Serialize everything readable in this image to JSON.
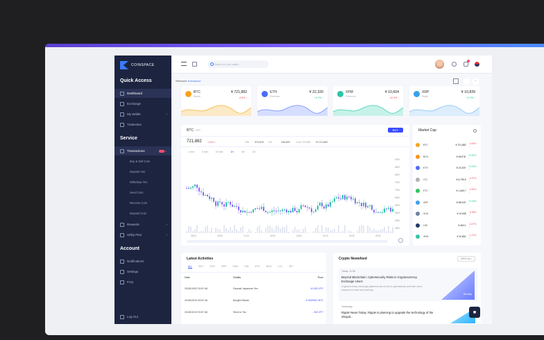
{
  "brand": "COINSPACE",
  "sidebar": {
    "quick_access": "Quick Access",
    "items": [
      "Dashboard",
      "Exchange",
      "My Wallet",
      "Tradeview"
    ],
    "service": "Service",
    "transactions": "Transactions",
    "sub": [
      "Buy & Sell Coin",
      "Deposit Yen",
      "Withdraw Yen",
      "Send Coin",
      "Receive Coin",
      "Deposit Coin"
    ],
    "more": [
      "Rewards",
      "Utility Plan"
    ],
    "account": "Account",
    "acc_items": [
      "Notifications",
      "Settings",
      "FAQ"
    ],
    "logout": "Log Out"
  },
  "search": {
    "placeholder": "Search for coin, wallet..."
  },
  "welcome": {
    "prefix": "Welcome",
    "name": "Koinsaoce"
  },
  "tickers": [
    {
      "name": "BTC",
      "sub": "Bitcoin",
      "price": "¥ 721,882",
      "change": "-4.6% ↓",
      "color": "#f7a41d",
      "up": false
    },
    {
      "name": "ETH",
      "sub": "Ethereum",
      "price": "¥ 22,320",
      "change": "+0.4% ↑",
      "color": "#4a6cf7",
      "up": true
    },
    {
      "name": "XPM",
      "sub": "Primecoin",
      "price": "¥ 10,604",
      "change": "-10.4% ↓",
      "color": "#2ec4a6",
      "up": false
    },
    {
      "name": "XRP",
      "sub": "Ripple",
      "price": "¥ 10,839",
      "change": "+0.4% ↑",
      "color": "#3aa0e8",
      "up": true
    }
  ],
  "chart": {
    "pair": "BTC",
    "pair_sub": "/ JPY",
    "price": "721,882",
    "change": "-4.6% ↓",
    "buy": "BUY",
    "stats": [
      "24h",
      "576,815",
      "Vol",
      "156,800",
      "Low 721,882",
      "Hi 721,882"
    ],
    "timeframes": [
      "1 min",
      "5 min",
      "15 min",
      "1H",
      "4H",
      "1D"
    ],
    "y_ticks": [
      "900K",
      "850K",
      "800K",
      "750K",
      "700K",
      "650K",
      "600K",
      "550K",
      "500K",
      "450K"
    ],
    "x_ticks": [
      "06:00",
      "09:00",
      "12:00",
      "15:00",
      "18:00",
      "21:00",
      "00:00",
      "03:00"
    ]
  },
  "market": {
    "title": "Market Cap",
    "rows": [
      {
        "sym": "BTC",
        "price": "¥ 721,882",
        "chg": "-4.63% ↓",
        "color": "#f7a41d",
        "up": false
      },
      {
        "sym": "BCH",
        "price": "¥ 46,678",
        "chg": "+3.52% ↑",
        "color": "#f7931a",
        "up": true
      },
      {
        "sym": "ETH",
        "price": "¥ 22,320",
        "chg": "+0.43% ↑",
        "color": "#4a6cf7",
        "up": true
      },
      {
        "sym": "LTC",
        "price": "¥ 6,795.5",
        "chg": "-0.37% ↓",
        "color": "#b0b0b0",
        "up": false
      },
      {
        "sym": "ETC",
        "price": "¥ 1,460.7",
        "chg": "-2.81% ↓",
        "color": "#2ec45a",
        "up": false
      },
      {
        "sym": "XRP",
        "price": "¥ 58.029",
        "chg": "+0.44% ↑",
        "color": "#3aa0e8",
        "up": true
      },
      {
        "sym": "XLM",
        "price": "¥ 13.548",
        "chg": "-3.38% ↓",
        "color": "#6e7fa8",
        "up": false
      },
      {
        "sym": "LSK",
        "price": "¥ 483.1",
        "chg": "-0.47% ↓",
        "color": "#1d3a6b",
        "up": false
      },
      {
        "sym": "XEM",
        "price": "¥ 10.851",
        "chg": "-1.01% ↓",
        "color": "#33c4a8",
        "up": false
      }
    ]
  },
  "activities": {
    "title": "Latest Activities",
    "tabs": [
      "ALL",
      "BTC",
      "ETH",
      "XRP",
      "XEM",
      "LSK",
      "ETC",
      "BCH",
      "LTC",
      "JPY"
    ],
    "headers": [
      "Date",
      "Details",
      "Price"
    ],
    "rows": [
      {
        "date": "2018/10/02 03:57:46",
        "detail": "Deposit Japanese Yen",
        "price": "10,000 JPY"
      },
      {
        "date": "2018/10/10 03:57:46",
        "detail": "Bought Bitcoin",
        "price": "- 0.0009097 BTC"
      },
      {
        "date": "2018/10/10 03:57:46",
        "detail": "Send to Tsc",
        "price": "- 300 JPY"
      }
    ]
  },
  "news": {
    "title": "Crypto Newsfeed",
    "button": "VIEW ALL",
    "today": "Today, 11:36",
    "headline": "Beyond Blockchain: Cybersecurity Risks to Cryptocurrency Exchange Users",
    "body": "Cryptocurrency exchange platforms are at risk of cyberattacks and their users exposed to fraud and phishing...",
    "tag": "Security",
    "yesterday": "Yesterday",
    "headline2": "Ripple News Today: Ripple is planning to upgrade the technology of the xRapid..."
  }
}
